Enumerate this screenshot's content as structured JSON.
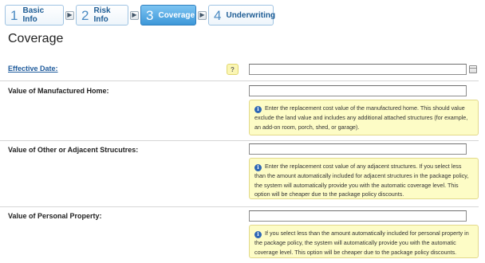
{
  "wizard": {
    "steps": [
      {
        "num": "1",
        "label": "Basic Info"
      },
      {
        "num": "2",
        "label": "Risk Info"
      },
      {
        "num": "3",
        "label": "Coverage"
      },
      {
        "num": "4",
        "label": "Underwriting"
      }
    ],
    "active_step": 3,
    "arrow_glyph": "▶"
  },
  "page": {
    "title": "Coverage"
  },
  "fields": {
    "effective_date": {
      "label": "Effective Date:",
      "value": "",
      "help_glyph": "?"
    },
    "manufactured_home": {
      "label": "Value of Manufactured Home:",
      "value": "",
      "note": "Enter the replacement cost value of the manufactured home. This should value exclude the land value and includes any additional attached structures (for example, an add-on room, porch, shed, or garage)."
    },
    "adjacent_structures": {
      "label": "Value of Other or Adjacent Strucutres:",
      "value": "",
      "note": "Enter the replacement cost value of any adjacent structures. If you select less than the amount automatically included for adjacent structures in the package policy, the system will automatically provide you with the automatic coverage level. This option will be cheaper due to the package policy discounts."
    },
    "personal_property": {
      "label": "Value of Personal Property:",
      "value": "",
      "note": "If you select less than the amount automatically included for personal property in the package policy, the system will automatically provide you with the automatic coverage level. This option will be cheaper due to the package policy discounts."
    }
  },
  "info_glyph": "i",
  "colors": {
    "accent": "#3d97d8",
    "link": "#1f5b9c",
    "note_bg": "#fdfcc6"
  }
}
